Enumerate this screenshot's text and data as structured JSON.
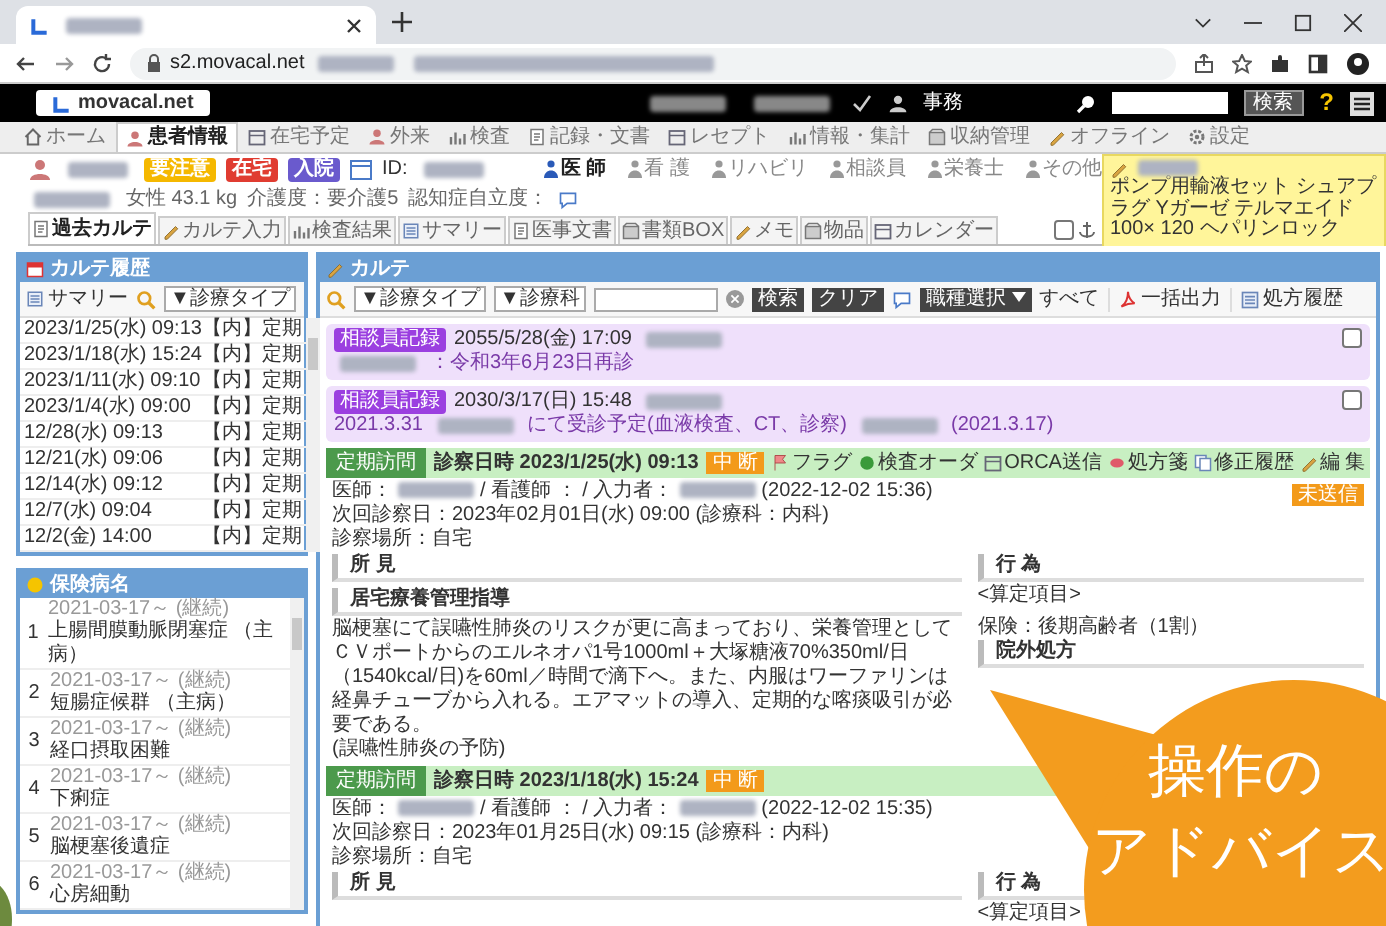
{
  "browser": {
    "url": "s2.movacal.net"
  },
  "header": {
    "logo": "movacal.net",
    "user": "事務",
    "search_button": "検索",
    "help": "?"
  },
  "nav": [
    {
      "label": "ホーム",
      "selected": false
    },
    {
      "label": "患者情報",
      "selected": true
    },
    {
      "label": "在宅予定",
      "selected": false
    },
    {
      "label": "外来",
      "selected": false
    },
    {
      "label": "検査",
      "selected": false
    },
    {
      "label": "記録・文書",
      "selected": false
    },
    {
      "label": "レセプト",
      "selected": false
    },
    {
      "label": "情報・集計",
      "selected": false
    },
    {
      "label": "収納管理",
      "selected": false
    },
    {
      "label": "オフライン",
      "selected": false
    },
    {
      "label": "設定",
      "selected": false
    }
  ],
  "patient": {
    "badges": [
      {
        "label": "要注意",
        "color": "#f5b800"
      },
      {
        "label": "在宅",
        "color": "#e03c31"
      },
      {
        "label": "入院",
        "color": "#6a5acd"
      }
    ],
    "id_label": "ID:",
    "info": [
      "女性 43.1 kg",
      "介護度：要介護5",
      "認知症自立度："
    ]
  },
  "roles": [
    {
      "label": "医 師",
      "selected": true
    },
    {
      "label": "看 護",
      "selected": false
    },
    {
      "label": "リハビリ",
      "selected": false
    },
    {
      "label": "相談員",
      "selected": false
    },
    {
      "label": "栄養士",
      "selected": false
    },
    {
      "label": "その他",
      "selected": false
    }
  ],
  "note": {
    "text": "ポンプ用輸液セット シュアプラグ Yガーゼ テルマエイド100× 120 ヘパリンロック"
  },
  "subtabs": [
    {
      "label": "過去カルテ",
      "selected": true
    },
    {
      "label": "カルテ入力",
      "selected": false
    },
    {
      "label": "検査結果",
      "selected": false
    },
    {
      "label": "サマリー",
      "selected": false
    },
    {
      "label": "医事文書",
      "selected": false
    },
    {
      "label": "書類BOX",
      "selected": false
    },
    {
      "label": "メモ",
      "selected": false
    },
    {
      "label": "物品",
      "selected": false
    },
    {
      "label": "カレンダー",
      "selected": false
    }
  ],
  "subtab_checkbox": {
    "checked": false
  },
  "history": {
    "title": "カルテ履歴",
    "summary_button": "サマリー",
    "filter": "▼診療タイプ",
    "rows": [
      {
        "date": "2023/1/25(水) 09:13",
        "type": "【内】定期"
      },
      {
        "date": "2023/1/18(水) 15:24",
        "type": "【内】定期"
      },
      {
        "date": "2023/1/11(水) 09:10",
        "type": "【内】定期"
      },
      {
        "date": "2023/1/4(水) 09:00",
        "type": "【内】定期"
      },
      {
        "date": "12/28(水) 09:13",
        "type": "【内】定期"
      },
      {
        "date": "12/21(水) 09:06",
        "type": "【内】定期"
      },
      {
        "date": "12/14(水) 09:12",
        "type": "【内】定期"
      },
      {
        "date": "12/7(水) 09:04",
        "type": "【内】定期"
      },
      {
        "date": "12/2(金) 14:00",
        "type": "【内】定期"
      }
    ]
  },
  "diseases": {
    "title": "保険病名",
    "items": [
      {
        "no": "1",
        "period": "2021-03-17～ (継続)",
        "name": "上腸間膜動脈閉塞症 （主病）"
      },
      {
        "no": "2",
        "period": "2021-03-17～ (継続)",
        "name": "短腸症候群 （主病）"
      },
      {
        "no": "3",
        "period": "2021-03-17～ (継続)",
        "name": "経口摂取困難"
      },
      {
        "no": "4",
        "period": "2021-03-17～ (継続)",
        "name": "下痢症"
      },
      {
        "no": "5",
        "period": "2021-03-17～ (継続)",
        "name": "脳梗塞後遺症"
      },
      {
        "no": "6",
        "period": "2021-03-17～ (継続)",
        "name": "心房細動"
      }
    ]
  },
  "karte": {
    "title": "カルテ",
    "toolbar": {
      "filter_type": "▼診療タイプ",
      "filter_dept": "▼診療科",
      "search": "検索",
      "clear": "クリア",
      "role_select": "職種選択",
      "all": "すべて",
      "export": "一括出力",
      "rx_history": "処方履歴"
    },
    "consult_records": [
      {
        "badge": "相談員記録",
        "datetime": "2055/5/28(金) 17:09",
        "body": [
          {
            "kind": "blur"
          },
          {
            "kind": "text",
            "text": "：令和3年6月23日再診"
          }
        ],
        "checked": false
      },
      {
        "badge": "相談員記録",
        "datetime": "2030/3/17(日) 15:48",
        "body": [
          {
            "kind": "text",
            "text": "2021.3.31"
          },
          {
            "kind": "blur"
          },
          {
            "kind": "text",
            "text": "にて受診予定(血液検査、CT、診察)"
          },
          {
            "kind": "blur"
          },
          {
            "kind": "text",
            "text": "(2021.3.17)"
          }
        ],
        "checked": false
      }
    ],
    "visits": [
      {
        "badge": "定期訪問",
        "datetime": "診察日時 2023/1/25(水) 09:13",
        "status": "中 断",
        "actions": [
          "フラグ",
          "検査オーダ",
          "ORCA送信",
          "処方箋",
          "修正履歴",
          "編 集"
        ],
        "send_status": "未送信",
        "staff": [
          {
            "kind": "text",
            "text": "医師："
          },
          {
            "kind": "blur"
          },
          {
            "kind": "text",
            "text": "/ 看護師 ： / 入力者："
          },
          {
            "kind": "blur"
          },
          {
            "kind": "text",
            "text": "(2022-12-02 15:36)"
          }
        ],
        "next": "次回診察日：2023年02月01日(水) 09:00 (診療科：内科)",
        "place": "診察場所：自宅",
        "findings_title": "所 見",
        "acts_title": "行 為",
        "acts": "<算定項目>",
        "guidance_title": "居宅療養管理指導",
        "guidance": "脳梗塞にて誤嚥性肺炎のリスクが更に高まっており、栄養管理としてＣＶポートからのエルネオパ1号1000ml＋大塚糖液70%350ml/日（1540kcal/日)を60ml／時間で滴下へ。また、内服はワーファリンは経鼻チューブから入れる。エアマットの導入、定期的な喀痰吸引が必要である。\n(誤嚥性肺炎の予防)",
        "insurance": "保険：後期高齢者（1割）",
        "prescription": "院外処方"
      },
      {
        "badge": "定期訪問",
        "datetime": "診察日時 2023/1/18(水) 15:24",
        "status": "中 断",
        "staff": [
          {
            "kind": "text",
            "text": "医師："
          },
          {
            "kind": "blur"
          },
          {
            "kind": "text",
            "text": "/ 看護師 ： / 入力者："
          },
          {
            "kind": "blur"
          },
          {
            "kind": "text",
            "text": "(2022-12-02 15:35)"
          }
        ],
        "next": "次回診察日：2023年01月25日(水) 09:15 (診療科：内科)",
        "place": "診察場所：自宅",
        "findings_title": "所 見",
        "acts_title": "行 為",
        "acts": "<算定項目>"
      }
    ]
  },
  "callout": [
    "操作の",
    "アドバイス"
  ]
}
